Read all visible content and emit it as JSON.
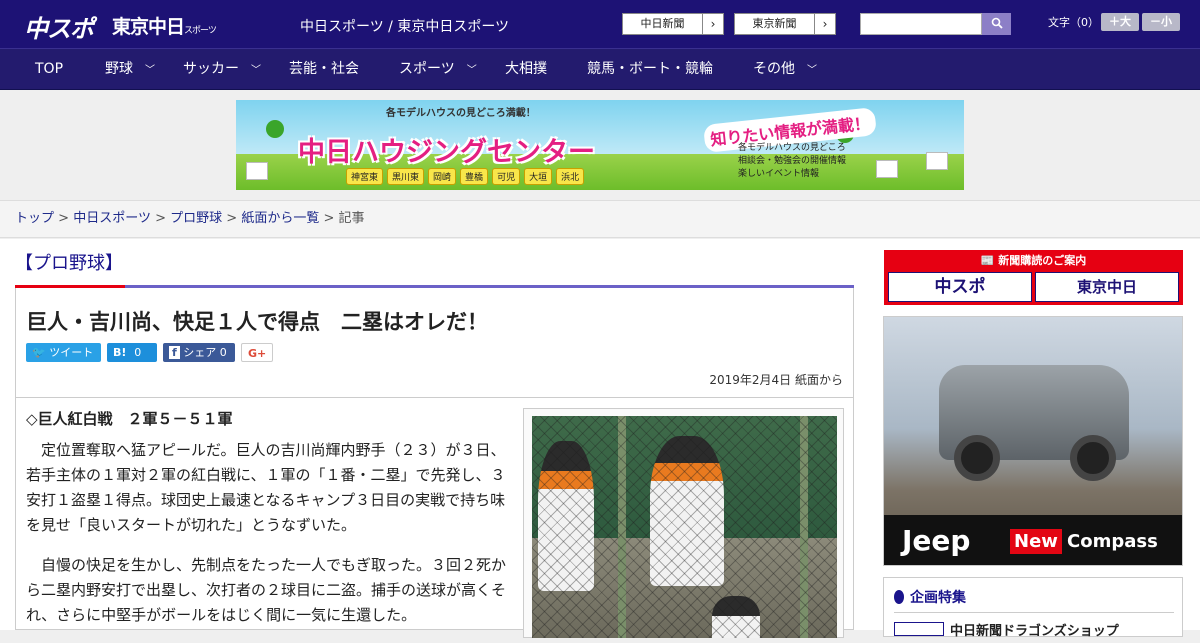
{
  "header": {
    "logo_chuspo": "中スポ",
    "logo_tokyo": "東京中日",
    "logo_tokyo_small": "スポーツ",
    "site_title": "中日スポーツ / 東京中日スポーツ",
    "ext_links": [
      {
        "label": "中日新聞",
        "arrow": "›"
      },
      {
        "label": "東京新聞",
        "arrow": "›"
      }
    ],
    "search": {
      "value": "",
      "button_icon": "search-icon"
    },
    "font_size": {
      "label": "文字（0）",
      "plus": "＋大",
      "minus": "－小"
    }
  },
  "nav": [
    {
      "label": "TOP",
      "chevron": false
    },
    {
      "label": "野球",
      "chevron": true
    },
    {
      "label": "サッカー",
      "chevron": true
    },
    {
      "label": "芸能・社会",
      "chevron": false
    },
    {
      "label": "スポーツ",
      "chevron": true
    },
    {
      "label": "大相撲",
      "chevron": false
    },
    {
      "label": "競馬・ボート・競輪",
      "chevron": false
    },
    {
      "label": "その他",
      "chevron": true
    }
  ],
  "banner": {
    "top": "各モデルハウスの見どころ満載！",
    "title": "中日ハウジングセンター",
    "right": "知りたい情報が満載！",
    "info": [
      "各モデルハウスの見どころ",
      "相談会・勉強会の開催情報",
      "楽しいイベント情報"
    ],
    "cities": [
      "神宮東",
      "黒川東",
      "岡崎",
      "豊橋",
      "可児",
      "大垣",
      "浜北"
    ]
  },
  "breadcrumb": {
    "links": [
      "トップ",
      "中日スポーツ",
      "プロ野球",
      "紙面から一覧"
    ],
    "separator": ">",
    "current": "記事"
  },
  "category": "【プロ野球】",
  "article": {
    "title": "巨人・吉川尚、快足１人で得点　二塁はオレだ！",
    "share": {
      "tweet": "ツイート",
      "hatena_icon": "B!",
      "hatena_count": "0",
      "facebook_icon": "f",
      "facebook_label": "シェア",
      "facebook_count": "0",
      "gplus": "G+"
    },
    "date": "2019年2月4日 紙面から",
    "lead": "◇巨人紅白戦　２軍５－５１軍",
    "paragraphs": [
      "定位置奪取へ猛アピールだ。巨人の吉川尚輝内野手（２３）が３日、若手主体の１軍対２軍の紅白戦に、１軍の「１番・二塁」で先発し、３安打１盗塁１得点。球団史上最速となるキャンプ３日目の実戦で持ち味を見せ「良いスタートが切れた」とうなずいた。",
      "自慢の快足を生かし、先制点をたった一人でもぎ取った。３回２死から二塁内野安打で出塁し、次打者の２球目に二盗。捕手の送球が高くそれ、さらに中堅手がボールをはじく間に一気に生還した。"
    ]
  },
  "sidebar": {
    "subscribe_title": "新聞購読のご案内",
    "subscribe_buttons": [
      "中スポ",
      "東京中日"
    ],
    "jeep_ad": {
      "brand": "Jeep",
      "new": "New",
      "model": "Compass"
    },
    "feature_title": "企画特集",
    "feature_item": "中日新聞ドラゴンズショップ"
  }
}
